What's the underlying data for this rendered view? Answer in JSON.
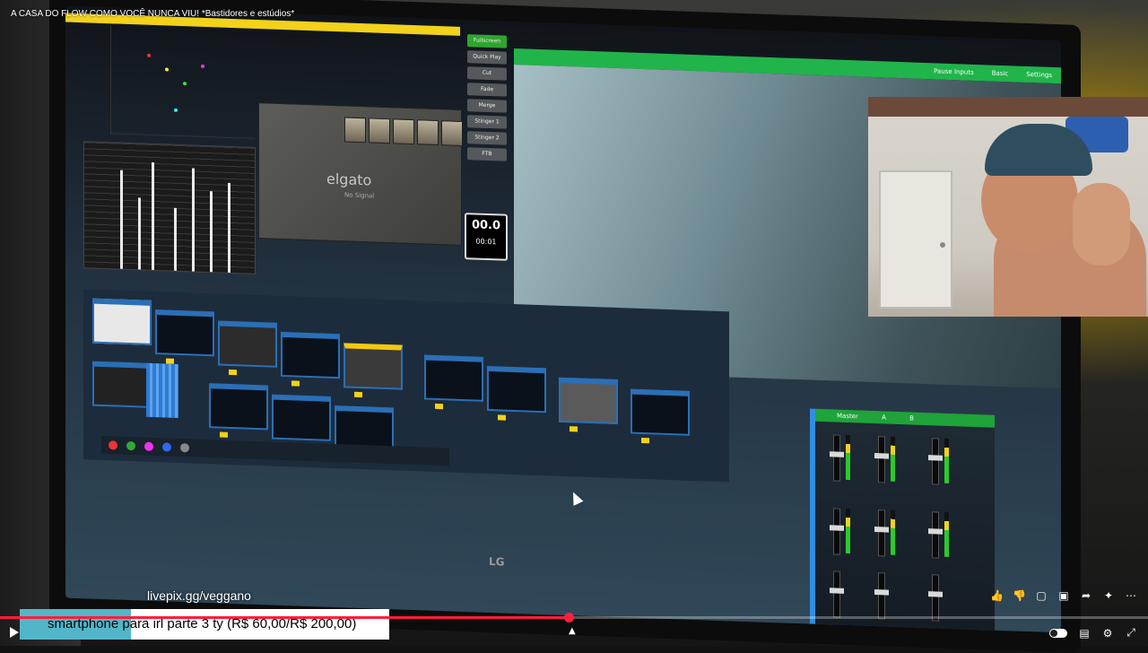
{
  "video": {
    "title": "A CASA DO FLOW COMO VOCÊ NUNCA VIU! *Bastidores e estúdios*",
    "overlay_url": "livepix.gg/veggano",
    "donation_text": "smartphone para irl parte 3 ty (R$ 60,00/R$ 200,00)",
    "donation_progress": 0.3,
    "playback_progress": 0.495
  },
  "screen": {
    "elgato_label": "elgato",
    "elgato_sub": "No Signal",
    "side_buttons": [
      "Fullscreen",
      "Quick Play",
      "Cut",
      "Fade",
      "Merge",
      "Stinger 1",
      "Stinger 2",
      "FTB"
    ],
    "clock_main": "00.0",
    "clock_sub": "00:01",
    "output_tabs": [
      "Pause Inputs",
      "Basic",
      "Settings"
    ],
    "mixer_header": [
      "Master",
      "A",
      "B"
    ],
    "monitor_brand": "LG"
  },
  "icons": {
    "like": "thumb-up-icon",
    "dislike": "thumb-down-icon",
    "comment": "comment-icon",
    "chat": "chat-icon",
    "share": "share-icon",
    "sparkle": "sparkle-icon",
    "more": "more-icon",
    "play": "play-icon",
    "captions": "captions-icon",
    "settings": "gear-icon",
    "fullscreen": "fullscreen-icon"
  },
  "colors": {
    "progress": "#ff1f3d",
    "donation_highlight": "#52b6c8",
    "output_green": "#21b44b",
    "accent_yellow": "#f2d21a"
  }
}
